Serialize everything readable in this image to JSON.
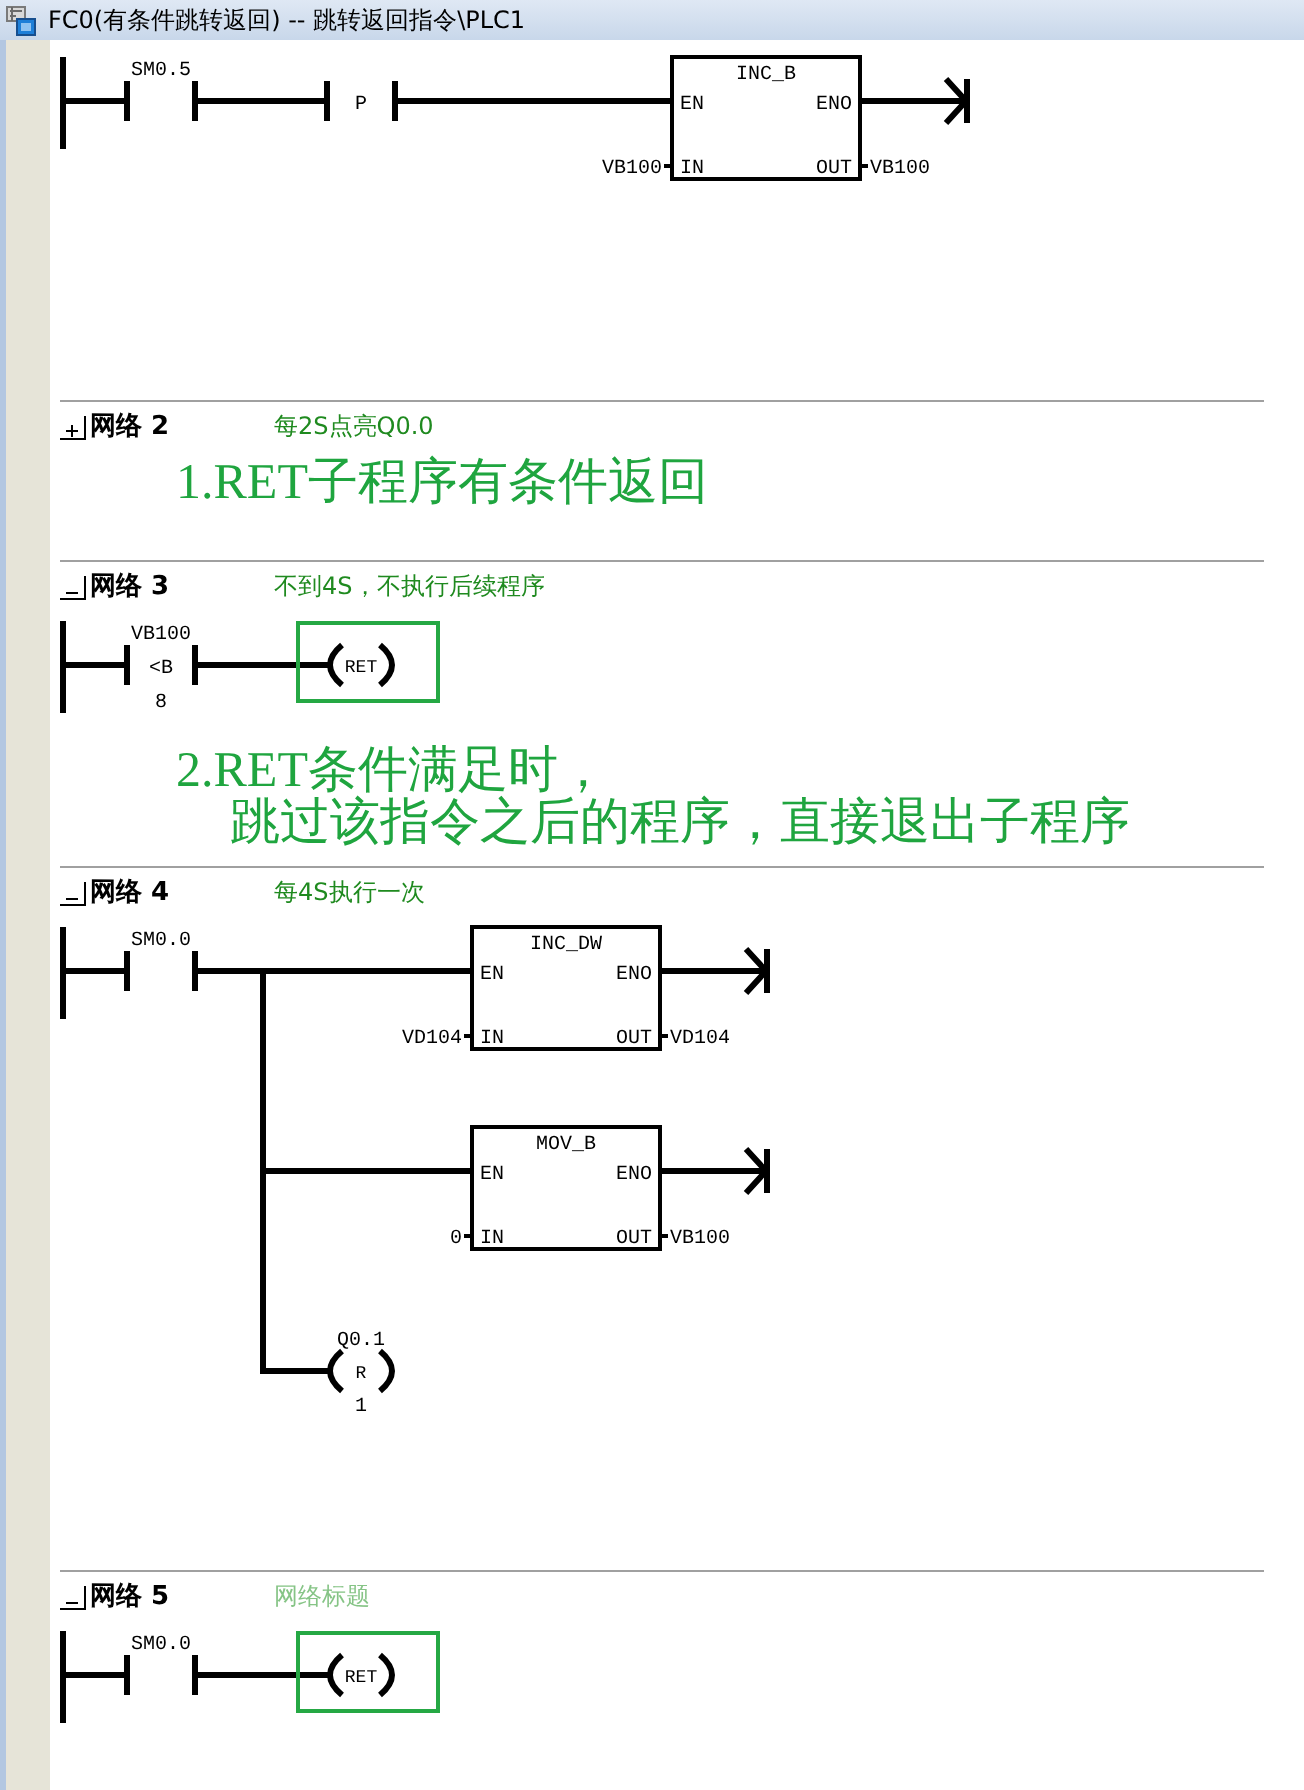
{
  "window": {
    "title": "FC0(有条件跳转返回) -- 跳转返回指令\\PLC1"
  },
  "top_network": {
    "rung": {
      "contacts": [
        {
          "kind": "contact",
          "address": "SM0.5"
        },
        {
          "kind": "edge",
          "symbol": "P"
        }
      ],
      "branches": [
        {
          "kind": "box",
          "name": "INC_B",
          "pins": {
            "en": "EN",
            "eno": "ENO",
            "in": "IN",
            "out": "OUT"
          },
          "input": "VB100",
          "output": "VB100"
        }
      ]
    }
  },
  "networks": [
    {
      "title": "网络 2",
      "expanded": false,
      "comment": "每2S点亮Q0.0",
      "note": [
        "1.RET子程序有条件返回"
      ]
    },
    {
      "title": "网络 3",
      "expanded": true,
      "comment": "不到4S，不执行后续程序",
      "rung": {
        "contacts": [
          {
            "kind": "compare",
            "address": "VB100",
            "symbol": "<B",
            "operand": "8"
          }
        ],
        "branches": [
          {
            "kind": "coil",
            "instruction": "RET",
            "highlighted": true
          }
        ]
      },
      "note": [
        "2.RET条件满足时，",
        "跳过该指令之后的程序，直接退出子程序"
      ]
    },
    {
      "title": "网络 4",
      "expanded": true,
      "comment": "每4S执行一次",
      "rung": {
        "contacts": [
          {
            "kind": "contact",
            "address": "SM0.0"
          }
        ],
        "branches": [
          {
            "kind": "box",
            "name": "INC_DW",
            "pins": {
              "en": "EN",
              "eno": "ENO",
              "in": "IN",
              "out": "OUT"
            },
            "input": "VD104",
            "output": "VD104"
          },
          {
            "kind": "box",
            "name": "MOV_B",
            "pins": {
              "en": "EN",
              "eno": "ENO",
              "in": "IN",
              "out": "OUT"
            },
            "input": "0",
            "output": "VB100"
          },
          {
            "kind": "coil",
            "instruction": "R",
            "address": "Q0.1",
            "operand": "1",
            "highlighted": false
          }
        ]
      }
    },
    {
      "title": "网络 5",
      "expanded": true,
      "placeholder": "网络标题",
      "rung": {
        "contacts": [
          {
            "kind": "contact",
            "address": "SM0.0"
          }
        ],
        "branches": [
          {
            "kind": "coil",
            "instruction": "RET",
            "highlighted": true
          }
        ]
      }
    }
  ]
}
